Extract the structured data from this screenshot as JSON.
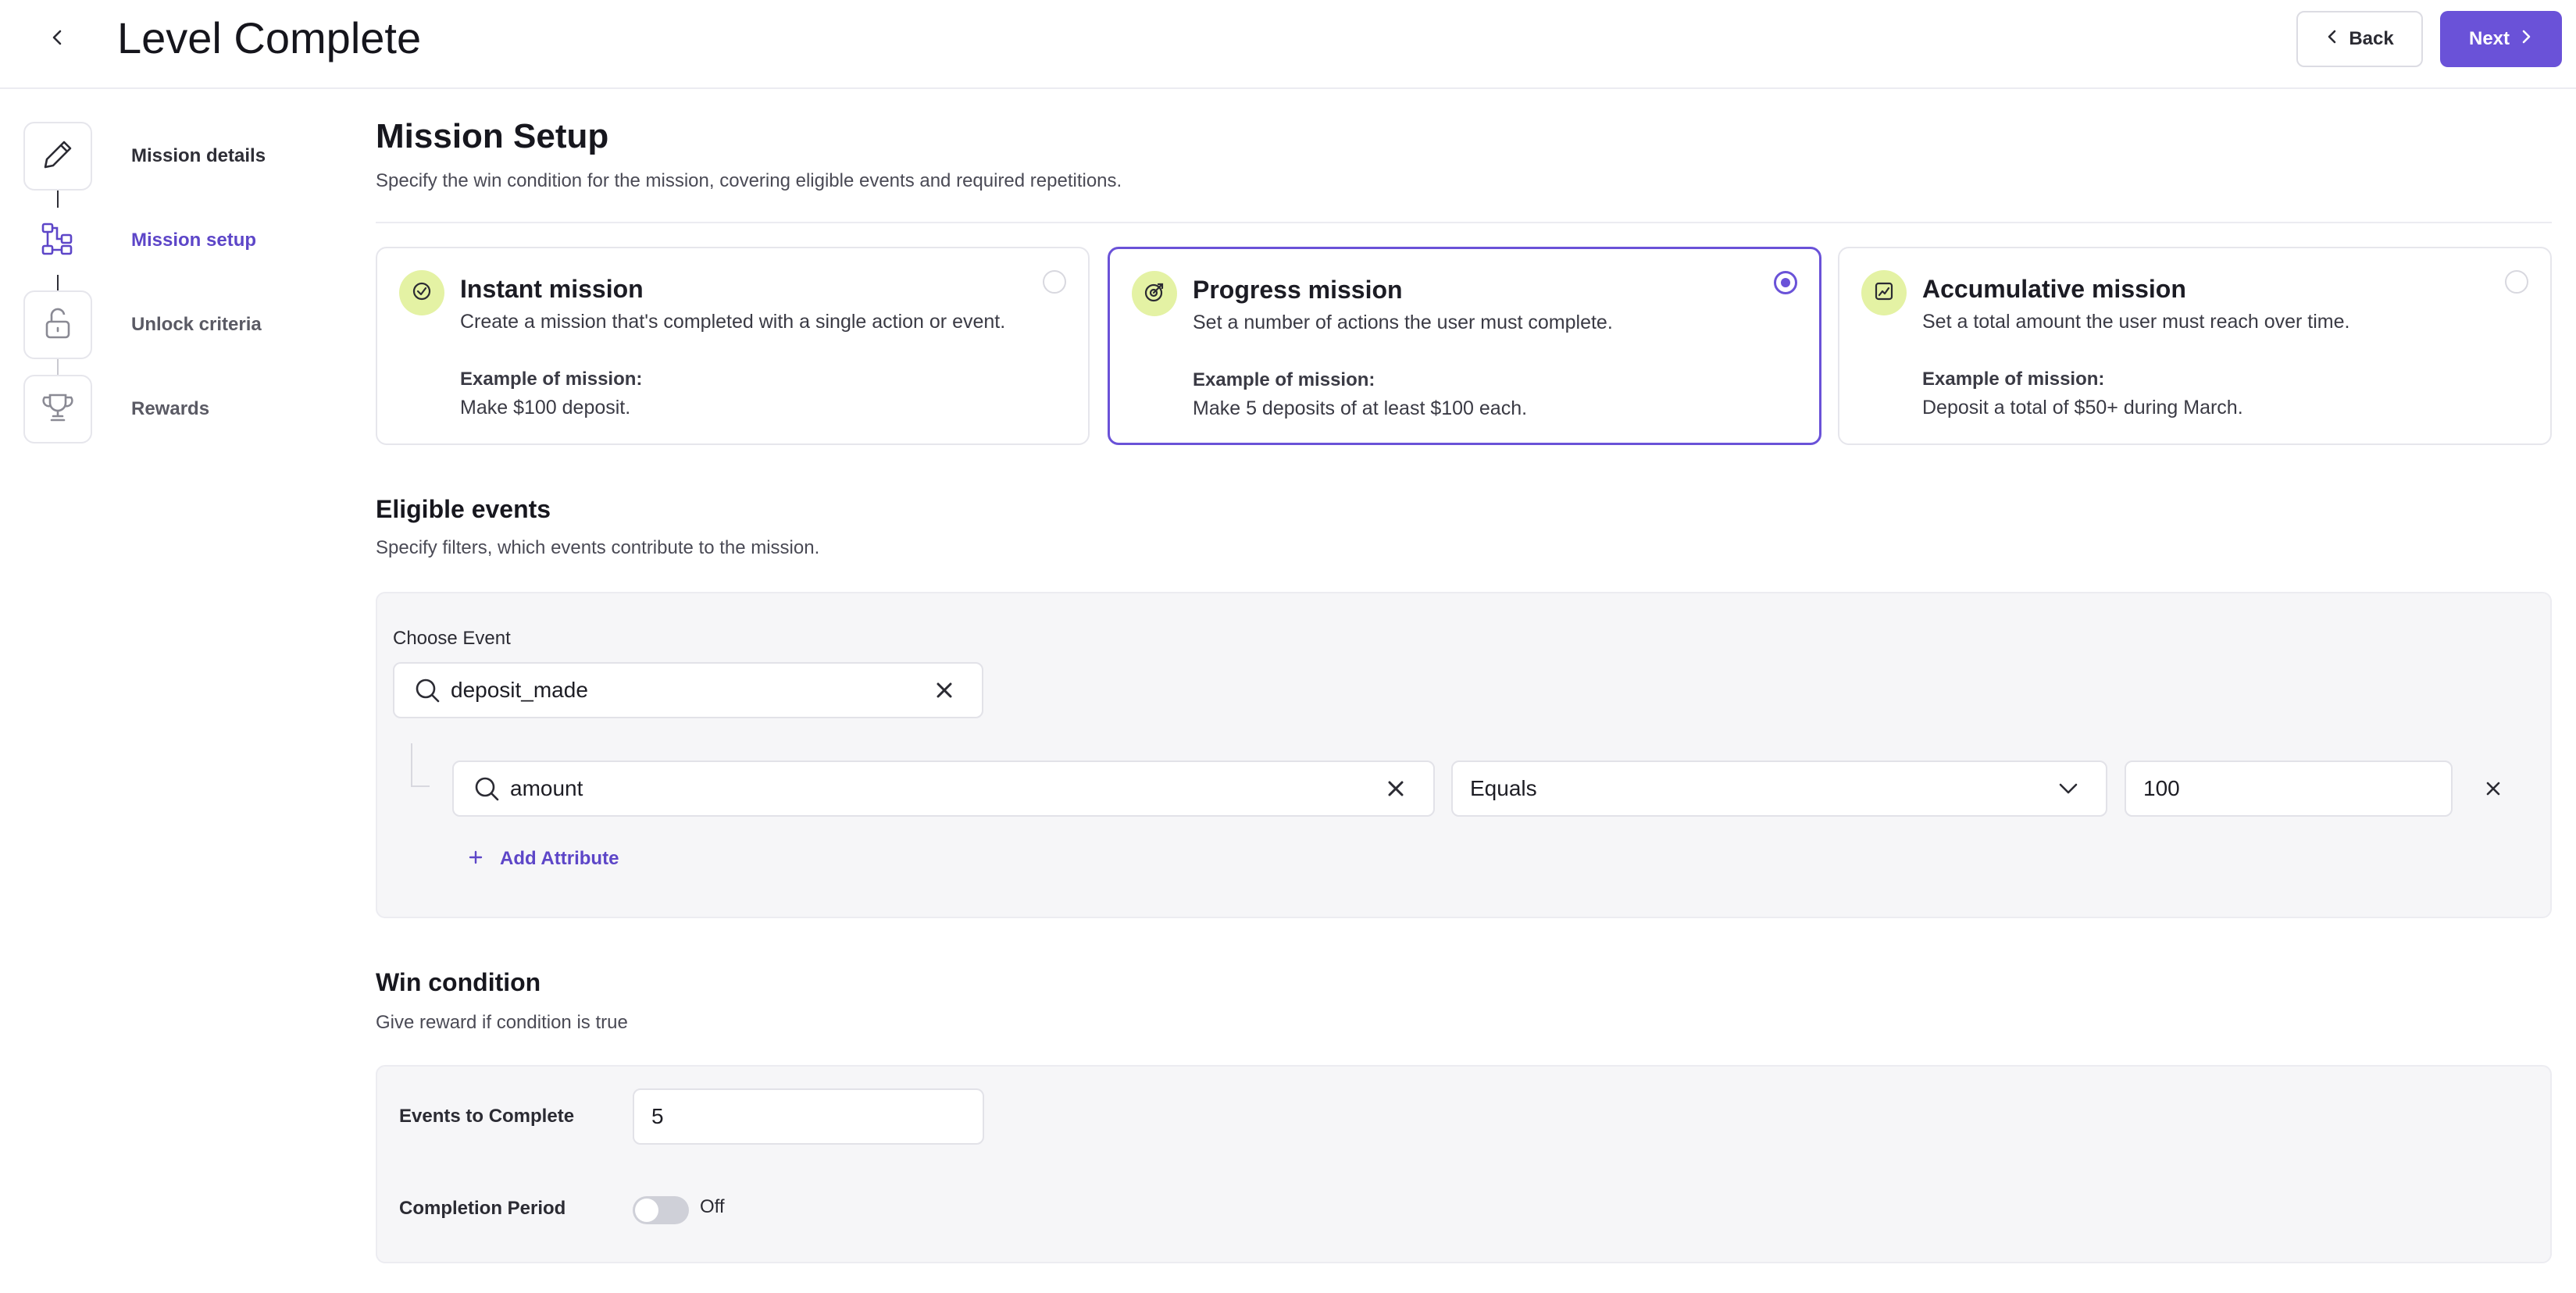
{
  "header": {
    "title": "Level Complete",
    "back_label": "Back",
    "next_label": "Next"
  },
  "stepper": {
    "steps": [
      {
        "label": "Mission details",
        "icon": "pencil-icon",
        "state": "done"
      },
      {
        "label": "Mission setup",
        "icon": "workflow-icon",
        "state": "active"
      },
      {
        "label": "Unlock criteria",
        "icon": "lock-icon",
        "state": "pending"
      },
      {
        "label": "Rewards",
        "icon": "trophy-icon",
        "state": "pending"
      }
    ]
  },
  "setup": {
    "title": "Mission Setup",
    "subtitle": "Specify the win condition for the mission, covering eligible events and required repetitions."
  },
  "mission_types": [
    {
      "title": "Instant mission",
      "description": "Create a mission that's completed with a single action or event.",
      "example_label": "Example of mission:",
      "example": "Make $100 deposit.",
      "selected": false,
      "icon": "check-circle-icon"
    },
    {
      "title": "Progress mission",
      "description": "Set a number of actions the user must complete.",
      "example_label": "Example of mission:",
      "example": "Make 5 deposits of at least $100 each.",
      "selected": true,
      "icon": "target-icon"
    },
    {
      "title": "Accumulative mission",
      "description": "Set a total amount the user must reach over time.",
      "example_label": "Example of mission:",
      "example": "Deposit a total of $50+ during March.",
      "selected": false,
      "icon": "chart-icon"
    }
  ],
  "eligible_events": {
    "title": "Eligible events",
    "subtitle": "Specify filters, which events contribute to the mission.",
    "choose_event_label": "Choose Event",
    "event_value": "deposit_made",
    "attribute": {
      "name": "amount",
      "operator": "Equals",
      "value": "100"
    },
    "add_attribute_label": "Add Attribute"
  },
  "win_condition": {
    "title": "Win condition",
    "subtitle": "Give reward if condition is true",
    "events_label": "Events to Complete",
    "events_value": "5",
    "period_label": "Completion Period",
    "period_state": "Off"
  },
  "colors": {
    "accent": "#6a52d8",
    "badge_bg": "#e4f2a4",
    "panel_bg": "#f6f6f8"
  }
}
